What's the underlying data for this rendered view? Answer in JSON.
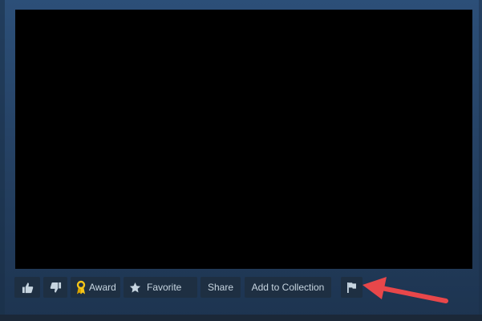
{
  "toolbar": {
    "vote_up_icon": "thumbs-up-icon",
    "vote_down_icon": "thumbs-down-icon",
    "award_icon": "award-ribbon-icon",
    "award_label": "Award",
    "favorite_icon": "star-icon",
    "favorite_label": "Favorite",
    "share_label": "Share",
    "add_to_collection_label": "Add to Collection",
    "report_icon": "flag-icon"
  },
  "annotation": {
    "arrow_color": "#e8474a",
    "points_to": "report-flag-button"
  },
  "colors": {
    "background": "#2a4b73",
    "video_background": "#000000",
    "button_background": "#1e2f42",
    "button_text": "#c7d5e0",
    "award_gold": "#f5c518"
  }
}
